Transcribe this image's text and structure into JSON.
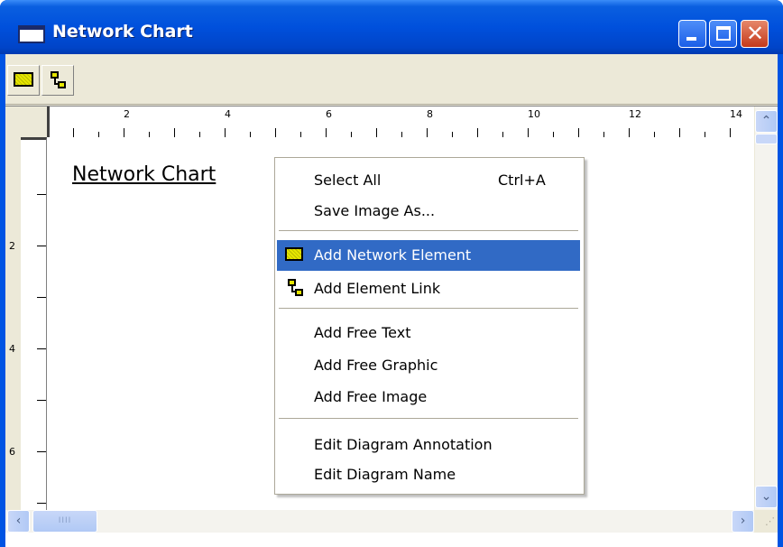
{
  "window": {
    "title": "Network Chart",
    "controls": {
      "minimize": "minimize",
      "maximize": "maximize",
      "close": "close"
    }
  },
  "toolbar": {
    "tools": [
      {
        "icon": "network-element-icon"
      },
      {
        "icon": "element-link-icon"
      }
    ]
  },
  "rulers": {
    "top_labels": [
      "2",
      "4",
      "6",
      "8",
      "10",
      "12",
      "14"
    ],
    "left_labels": [
      "2",
      "4",
      "6"
    ]
  },
  "canvas": {
    "chart_title": "Network Chart"
  },
  "context_menu": {
    "items": [
      {
        "label": "Select All",
        "accelerator": "Ctrl+A"
      },
      {
        "label": "Save Image As..."
      },
      {
        "label": "Add Network Element",
        "icon": "network-element-icon",
        "highlighted": true
      },
      {
        "label": "Add Element Link",
        "icon": "element-link-icon"
      },
      {
        "label": "Add Free Text"
      },
      {
        "label": "Add Free Graphic"
      },
      {
        "label": "Add Free Image"
      },
      {
        "label": "Edit Diagram Annotation"
      },
      {
        "label": "Edit Diagram Name"
      }
    ]
  },
  "scrollbars": {
    "hthumb_grip": "IIII",
    "up_arrow": "⌃",
    "down_arrow": "⌄",
    "left_arrow": "‹",
    "right_arrow": "›"
  },
  "colors": {
    "title_bar": "#0054e3",
    "menu_highlight": "#316ac5",
    "element_fill": "#e6e600"
  }
}
